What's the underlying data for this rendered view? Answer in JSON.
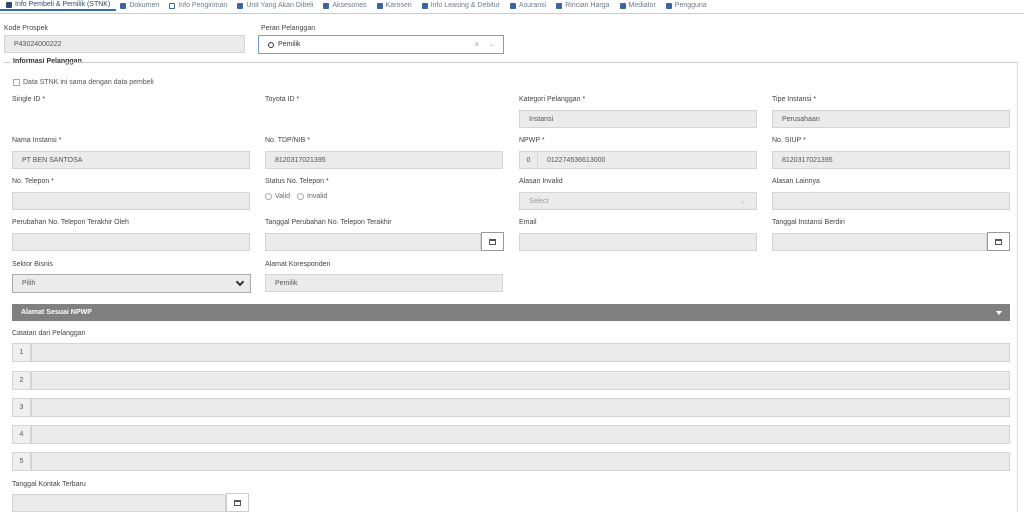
{
  "tabs": [
    {
      "label": "Info Pembeli & Pemilik (STNK)",
      "icon": "user-icon",
      "active": true
    },
    {
      "label": "Dokumen",
      "icon": "folder-icon"
    },
    {
      "label": "Info Pengiriman",
      "icon": "calendar-icon"
    },
    {
      "label": "Unit Yang Akan Dibeli",
      "icon": "car-icon"
    },
    {
      "label": "Aksesories",
      "icon": "gears-icon"
    },
    {
      "label": "Karoseri",
      "icon": "wrench-icon"
    },
    {
      "label": "Info Leasing & Debitur",
      "icon": "handshake-icon"
    },
    {
      "label": "Asuransi",
      "icon": "umbrella-icon"
    },
    {
      "label": "Rincian Harga",
      "icon": "money-icon"
    },
    {
      "label": "Mediator",
      "icon": "group-icon"
    },
    {
      "label": "Pengguna",
      "icon": "user-icon"
    }
  ],
  "header": {
    "kode_prospek_label": "Kode Prospek",
    "kode_prospek_value": "P43024000222",
    "peran_label": "Peran Pelanggan",
    "peran_value": "Pemilik"
  },
  "section": {
    "legend": "Informasi Pelanggan",
    "checkbox_label": "Data STNK ini sama dengan data pembeli"
  },
  "fields": {
    "single_id_label": "Single ID *",
    "toyota_id_label": "Toyota ID *",
    "kategori_label": "Kategori Pelanggan *",
    "kategori_value": "Instansi",
    "tipe_label": "Tipe Instansi *",
    "tipe_value": "Perusahaan",
    "nama_label": "Nama Instansi *",
    "nama_value": "PT BEN SANTOSA",
    "tdp_label": "No. TDP/NIB *",
    "tdp_value": "8120317021395",
    "npwp_label": "NPWP *",
    "npwp_prefix": "0",
    "npwp_value": "012274536613000",
    "siup_label": "No. SIUP *",
    "siup_value": "8120317021395",
    "telepon_label": "No. Telepon *",
    "status_label": "Status No. Telepon *",
    "status_valid": "Valid",
    "status_invalid": "Invalid",
    "alasan_label": "Alasan Invalid",
    "alasan_value": "Select",
    "alasan_lain_label": "Alasan Lainnya",
    "perubahan_label": "Perubahan No. Telepon Terakhir Oleh",
    "tgl_perubahan_label": "Tanggal Perubahan No. Telepon Terakhir",
    "email_label": "Email",
    "tgl_berdiri_label": "Tanggal Instansi Berdiri",
    "sektor_label": "Sektor Bisnis",
    "sektor_value": "Pilih",
    "alamat_label": "Alamat Koresponden",
    "alamat_value": "Pemilik"
  },
  "npwp_section": {
    "banner": "Alamat Sesuai NPWP",
    "catatan_label": "Catatan dari Pelanggan",
    "rows": [
      "1",
      "2",
      "3",
      "4",
      "5"
    ],
    "tgl_kontak_label": "Tanggal Kontak Terbaru"
  }
}
